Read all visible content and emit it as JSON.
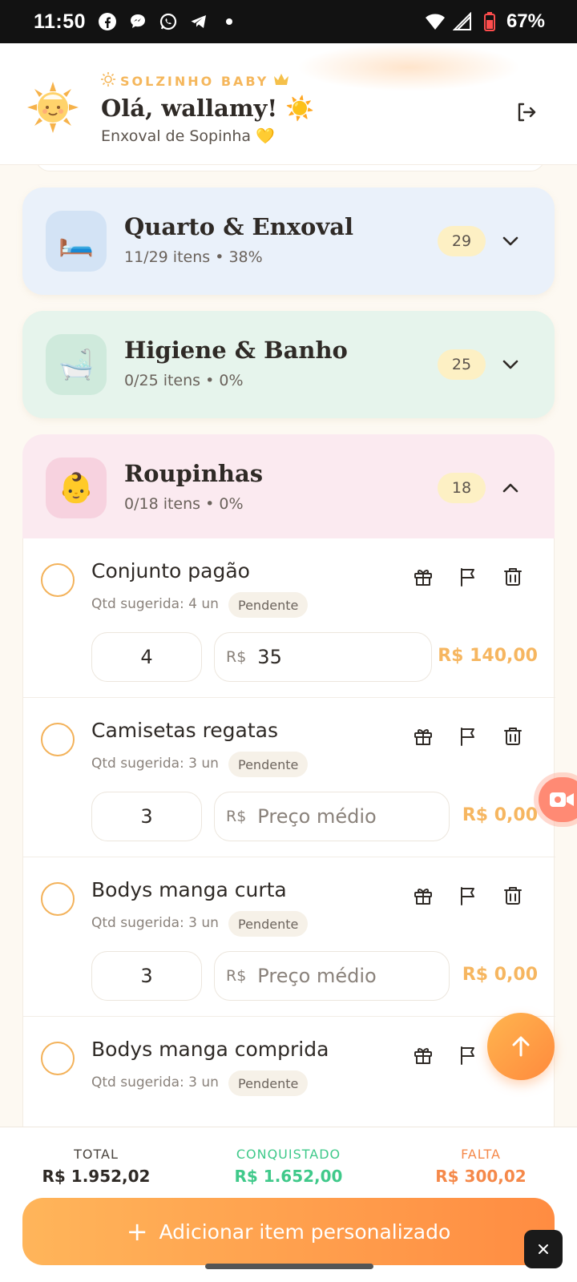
{
  "status_bar": {
    "time": "11:50",
    "battery": "67%",
    "icons": [
      "facebook-icon",
      "chat-icon",
      "whatsapp-icon",
      "telegram-icon",
      "dot-icon",
      "wifi-icon",
      "signal-icon",
      "battery-icon"
    ]
  },
  "header": {
    "brand": "SOLZINHO BABY",
    "greeting": "Olá, wallamy! ☀️",
    "subtitle": "Enxoval de Sopinha 💛"
  },
  "categories": [
    {
      "icon": "🛏️",
      "title": "Quarto & Enxoval",
      "sub": "11/29 itens • 38%",
      "count": "29",
      "bg": "#eaf1fa",
      "icon_bg": "#d3e3f5",
      "expanded": false
    },
    {
      "icon": "🛁",
      "title": "Higiene & Banho",
      "sub": "0/25 itens • 0%",
      "count": "25",
      "bg": "#e6f4ec",
      "icon_bg": "#cfeadc",
      "expanded": false
    },
    {
      "icon": "👶",
      "title": "Roupinhas",
      "sub": "0/18 itens • 0%",
      "count": "18",
      "bg": "#fbeaf0",
      "icon_bg": "#f7d2df",
      "expanded": true
    }
  ],
  "items": [
    {
      "name": "Conjunto pagão",
      "qty_suggested": "Qtd sugerida: 4 un",
      "status": "Pendente",
      "qty": "4",
      "price_prefix": "R$",
      "price": "35",
      "price_placeholder": "",
      "total": "R$ 140,00"
    },
    {
      "name": "Camisetas regatas",
      "qty_suggested": "Qtd sugerida: 3 un",
      "status": "Pendente",
      "qty": "3",
      "price_prefix": "R$",
      "price": "",
      "price_placeholder": "Preço médio",
      "total": "R$ 0,00"
    },
    {
      "name": "Bodys manga curta",
      "qty_suggested": "Qtd sugerida: 3 un",
      "status": "Pendente",
      "qty": "3",
      "price_prefix": "R$",
      "price": "",
      "price_placeholder": "Preço médio",
      "total": "R$ 0,00"
    },
    {
      "name": "Bodys manga comprida",
      "qty_suggested": "Qtd sugerida: 3 un",
      "status": "Pendente",
      "qty": "",
      "price_prefix": "",
      "price": "",
      "price_placeholder": "",
      "total": ""
    }
  ],
  "footer": {
    "total_label": "TOTAL",
    "total_value": "R$ 1.952,02",
    "conquistado_label": "CONQUISTADO",
    "conquistado_value": "R$ 1.652,00",
    "falta_label": "FALTA",
    "falta_value": "R$ 300,02",
    "add_button_plus": "+",
    "add_button_label": "Adicionar item personalizado"
  },
  "colors": {
    "accent": "#ff8c42",
    "accent_light": "#f6b660",
    "conquistado": "#3fc98a",
    "falta": "#f5894a"
  }
}
